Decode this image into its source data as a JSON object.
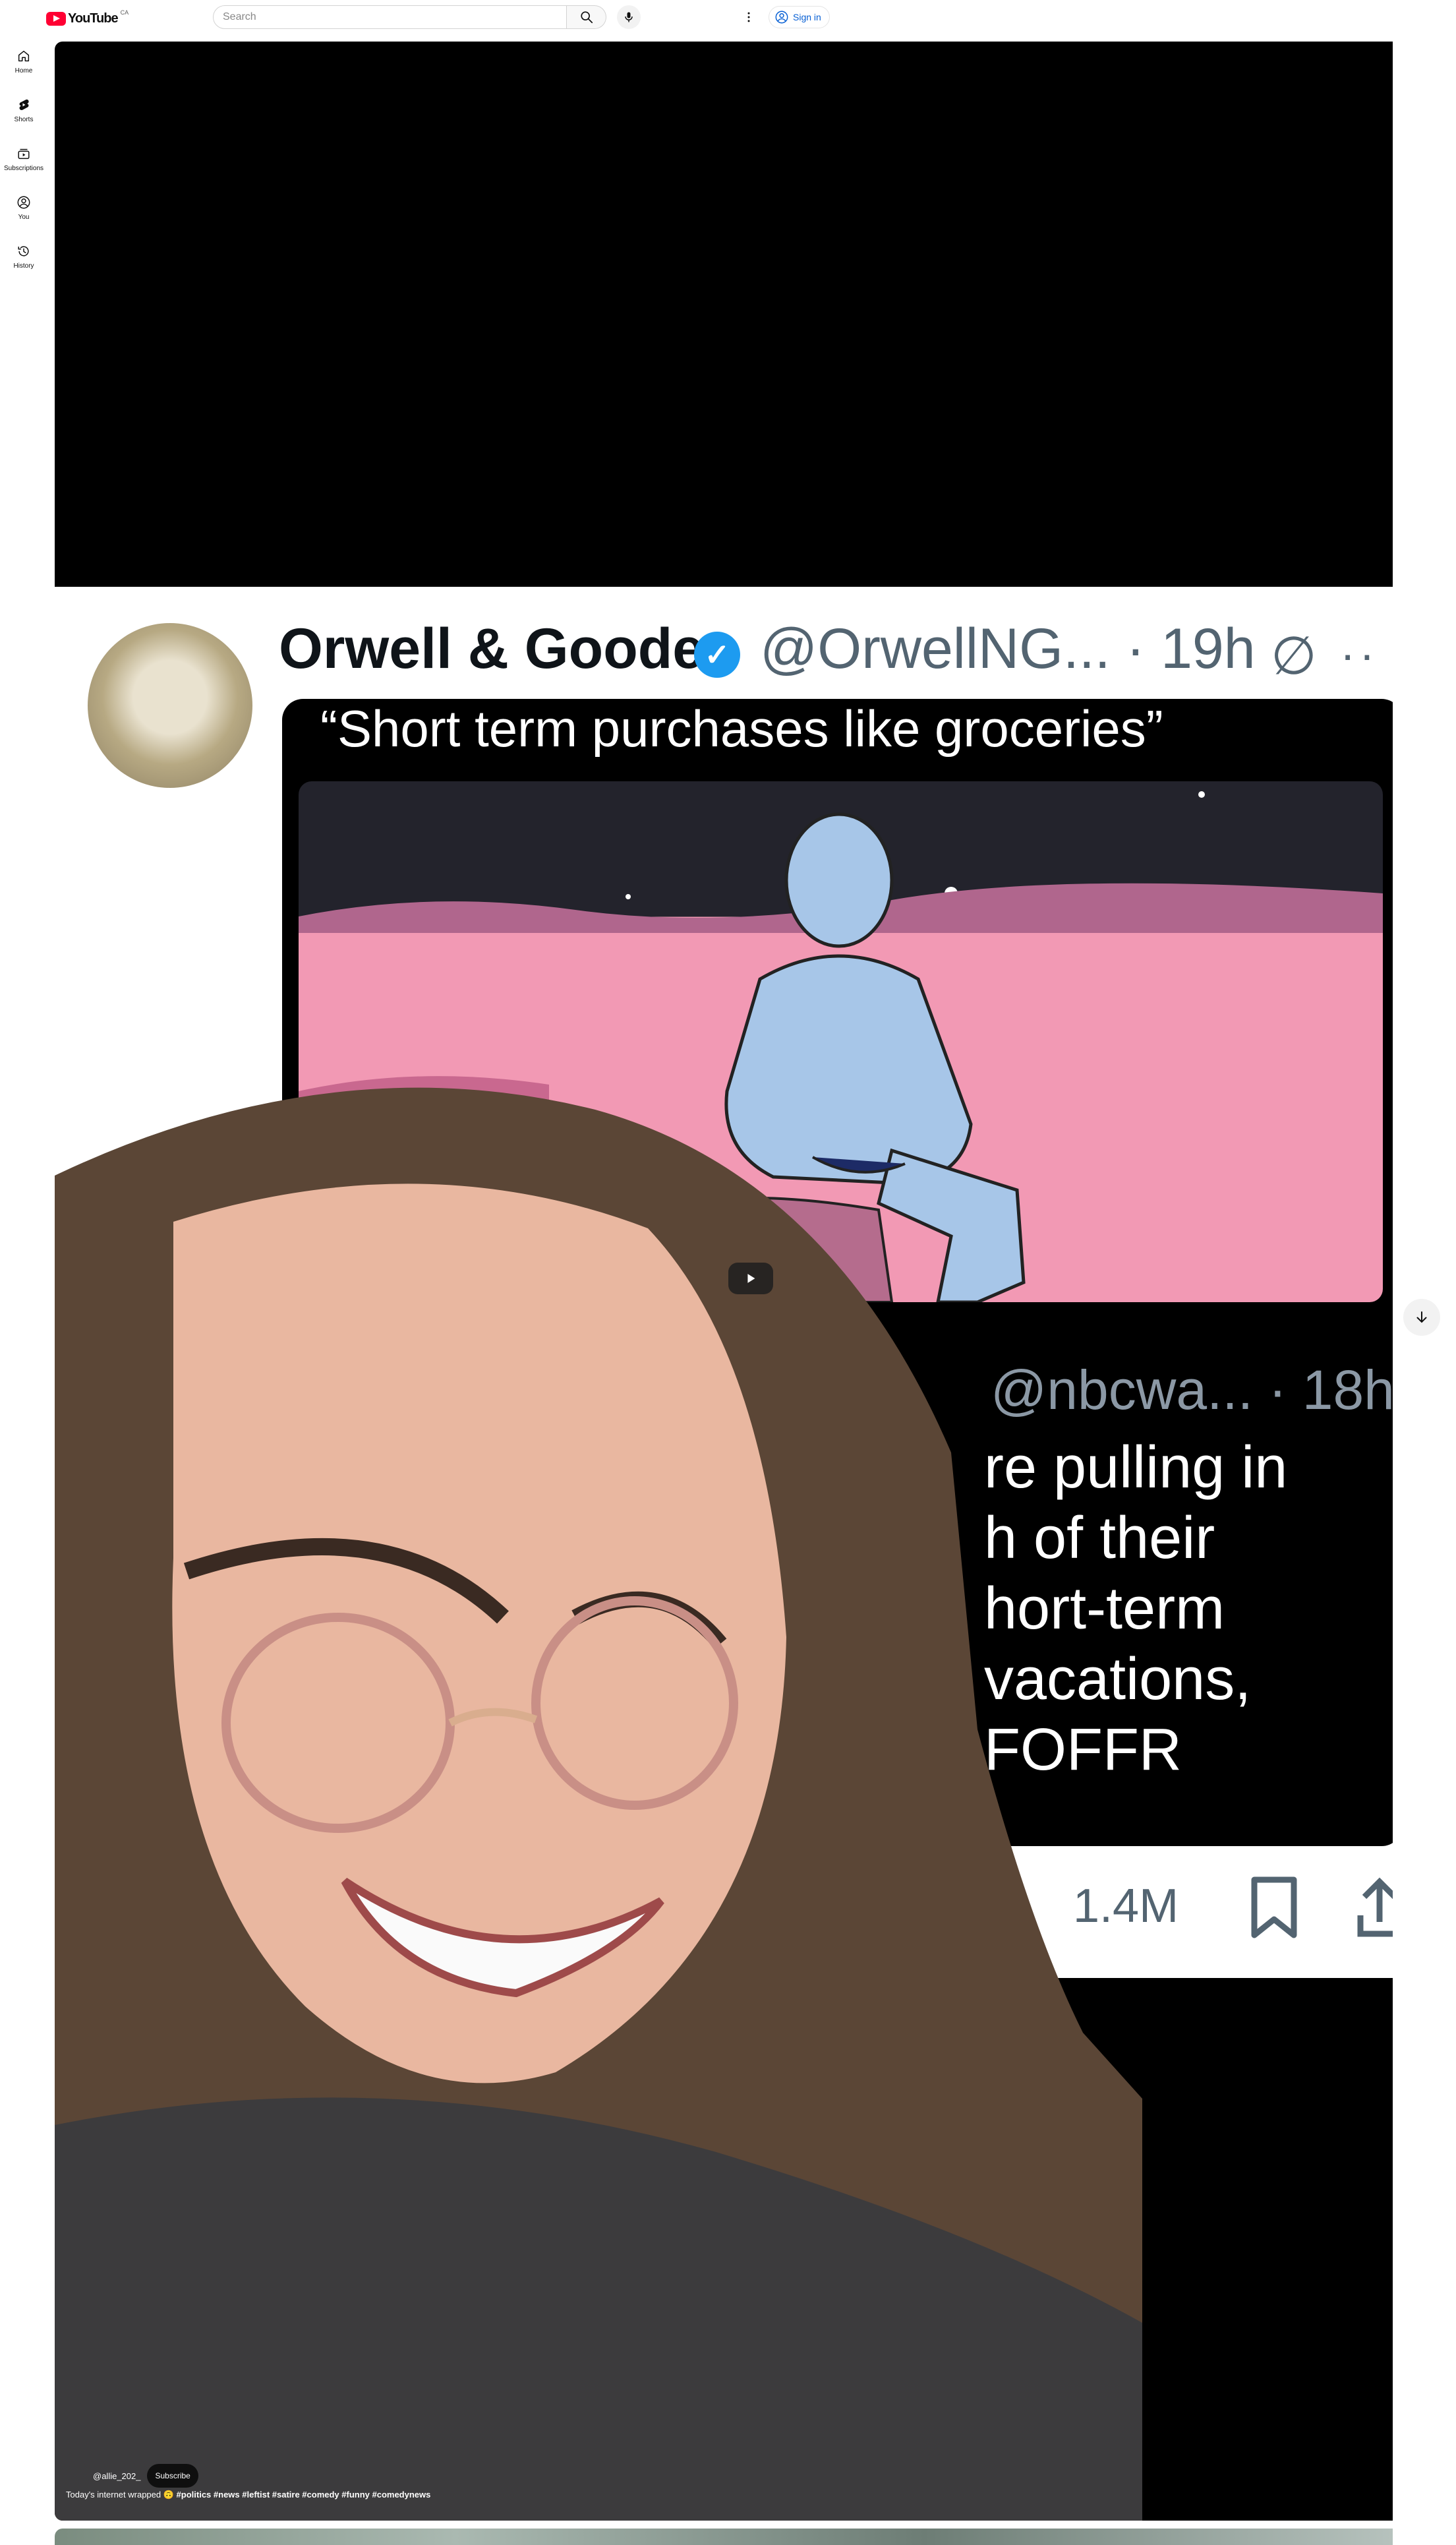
{
  "masthead": {
    "logo_text": "YouTube",
    "logo_country": "CA",
    "search_placeholder": "Search",
    "signin_label": "Sign in"
  },
  "guide": {
    "items": [
      {
        "label": "Home",
        "icon": "home-icon"
      },
      {
        "label": "Shorts",
        "icon": "shorts-icon"
      },
      {
        "label": "Subscriptions",
        "icon": "subscriptions-icon"
      },
      {
        "label": "You",
        "icon": "you-icon"
      },
      {
        "label": "History",
        "icon": "history-icon"
      }
    ]
  },
  "video": {
    "tweet_name": "Orwell & Goode",
    "tweet_handle": "@OrwellNG... · 19h",
    "quote_title": "“Short term purchases like groceries”",
    "subquote_handle": "@nbcwa... · 18h",
    "subquote_lines": [
      "re pulling in",
      "h of their",
      "hort-term",
      "vacations,",
      "FOFFR"
    ],
    "stat_views": "1.4M",
    "channel": "@allie_202_",
    "subscribe_label": "Subscribe",
    "caption_text": "Today's internet wrapped 🙃",
    "caption_tags": "#politics #news #leftist #satire #comedy #funny #comedynews"
  },
  "colors": {
    "brand_red": "#ff0033",
    "link_blue": "#065fd4",
    "verified_blue": "#1d9bf0"
  }
}
